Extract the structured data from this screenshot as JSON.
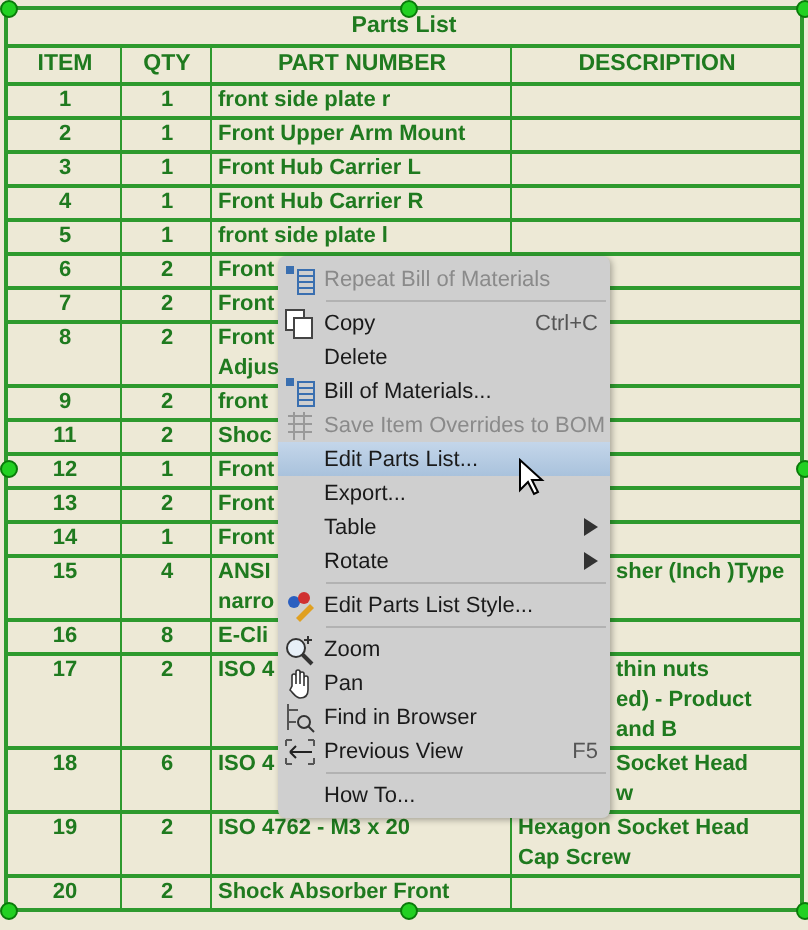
{
  "table": {
    "title": "Parts List",
    "columns": [
      "ITEM",
      "QTY",
      "PART NUMBER",
      "DESCRIPTION"
    ],
    "rows": [
      {
        "item": "1",
        "qty": "1",
        "part": [
          "front side plate r"
        ],
        "description": []
      },
      {
        "item": "2",
        "qty": "1",
        "part": [
          "Front Upper Arm Mount"
        ],
        "description": []
      },
      {
        "item": "3",
        "qty": "1",
        "part": [
          "Front Hub Carrier L"
        ],
        "description": []
      },
      {
        "item": "4",
        "qty": "1",
        "part": [
          "Front Hub Carrier R"
        ],
        "description": []
      },
      {
        "item": "5",
        "qty": "1",
        "part": [
          "front side plate l"
        ],
        "description": []
      },
      {
        "item": "6",
        "qty": "2",
        "part": [
          "Front"
        ],
        "description": []
      },
      {
        "item": "7",
        "qty": "2",
        "part": [
          "Front"
        ],
        "description": []
      },
      {
        "item": "8",
        "qty": "2",
        "part": [
          "Front",
          "Adjus"
        ],
        "description": []
      },
      {
        "item": "9",
        "qty": "2",
        "part": [
          "front"
        ],
        "description": []
      },
      {
        "item": "11",
        "qty": "2",
        "part": [
          "Shoc"
        ],
        "description": []
      },
      {
        "item": "12",
        "qty": "1",
        "part": [
          "Front"
        ],
        "description": []
      },
      {
        "item": "13",
        "qty": "2",
        "part": [
          "Front"
        ],
        "description": []
      },
      {
        "item": "14",
        "qty": "1",
        "part": [
          "Front"
        ],
        "description": []
      },
      {
        "item": "15",
        "qty": "4",
        "part": [
          "ANSI",
          "narro"
        ],
        "description": [
          "sher (Inch )Type"
        ]
      },
      {
        "item": "16",
        "qty": "8",
        "part": [
          "E-Cli"
        ],
        "description": []
      },
      {
        "item": "17",
        "qty": "2",
        "part": [
          "ISO 4"
        ],
        "description": [
          "thin nuts",
          "ed) - Product",
          "and B"
        ]
      },
      {
        "item": "18",
        "qty": "6",
        "part": [
          "ISO 4"
        ],
        "description": [
          "Socket Head",
          "w"
        ]
      },
      {
        "item": "19",
        "qty": "2",
        "part": [
          "ISO 4762 - M3 x 20"
        ],
        "description": [
          "Hexagon Socket Head",
          "Cap Screw"
        ]
      },
      {
        "item": "20",
        "qty": "2",
        "part": [
          "Shock Absorber Front"
        ],
        "description": []
      }
    ]
  },
  "context_menu": {
    "items": [
      {
        "kind": "item",
        "label": "Repeat Bill of Materials",
        "disabled": true,
        "selected": false
      },
      {
        "kind": "separator"
      },
      {
        "kind": "item",
        "label": "Copy",
        "shortcut": "Ctrl+C",
        "disabled": false,
        "selected": false
      },
      {
        "kind": "item",
        "label": "Delete",
        "disabled": false,
        "selected": false
      },
      {
        "kind": "item",
        "label": "Bill of Materials...",
        "disabled": false,
        "selected": false
      },
      {
        "kind": "item",
        "label": "Save Item Overrides to BOM",
        "disabled": true,
        "selected": false
      },
      {
        "kind": "item",
        "label": "Edit Parts List...",
        "disabled": false,
        "selected": true
      },
      {
        "kind": "item",
        "label": "Export...",
        "disabled": false,
        "selected": false
      },
      {
        "kind": "item",
        "label": "Table",
        "submenu": true,
        "disabled": false,
        "selected": false
      },
      {
        "kind": "item",
        "label": "Rotate",
        "submenu": true,
        "disabled": false,
        "selected": false
      },
      {
        "kind": "separator"
      },
      {
        "kind": "item",
        "label": "Edit Parts List Style...",
        "disabled": false,
        "selected": false
      },
      {
        "kind": "separator"
      },
      {
        "kind": "item",
        "label": "Zoom",
        "disabled": false,
        "selected": false
      },
      {
        "kind": "item",
        "label": "Pan",
        "disabled": false,
        "selected": false
      },
      {
        "kind": "item",
        "label": "Find in Browser",
        "disabled": false,
        "selected": false
      },
      {
        "kind": "item",
        "label": "Previous View",
        "shortcut": "F5",
        "disabled": false,
        "selected": false
      },
      {
        "kind": "separator"
      },
      {
        "kind": "item",
        "label": "How To...",
        "disabled": false,
        "selected": false
      }
    ]
  }
}
